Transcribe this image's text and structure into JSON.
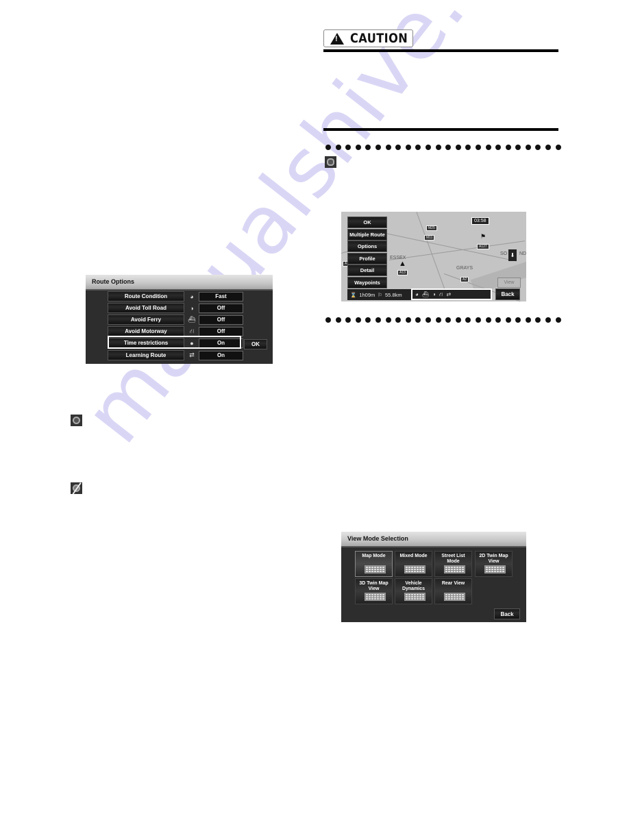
{
  "watermark": "manualshive.com",
  "caution": {
    "label": "CAUTION",
    "icon": "warning-triangle-icon"
  },
  "inline_icons": {
    "setting_icon": "route-setting-icon",
    "on_icon": "option-on-icon",
    "off_icon": "option-off-icon"
  },
  "route_options_screen": {
    "title": "Route Options",
    "rows": [
      {
        "label": "Route Condition",
        "icon": "route-condition-icon",
        "glyph": "◕",
        "value": "Fast"
      },
      {
        "label": "Avoid Toll Road",
        "icon": "toll-road-icon",
        "glyph": "◑",
        "value": "Off"
      },
      {
        "label": "Avoid Ferry",
        "icon": "ferry-icon",
        "glyph": "⛴",
        "value": "Off"
      },
      {
        "label": "Avoid Motorway",
        "icon": "motorway-icon",
        "glyph": "⛙",
        "value": "Off"
      },
      {
        "label": "Time restrictions",
        "icon": "time-restriction-icon",
        "glyph": "●",
        "value": "On"
      },
      {
        "label": "Learning Route",
        "icon": "learning-route-icon",
        "glyph": "⇄",
        "value": "On"
      }
    ],
    "selected_row": "Time restrictions",
    "ok_label": "OK"
  },
  "route_map_screen": {
    "menu": [
      "OK",
      "Multiple Route",
      "Options",
      "Profile",
      "Detail",
      "Waypoints"
    ],
    "clock": "03:58",
    "travel_time": "1h09m",
    "distance": "55.8km",
    "status_icons": [
      "route-condition-icon",
      "ferry-icon",
      "toll-road-icon",
      "motorway-icon",
      "learning-route-icon"
    ],
    "view_label": "View",
    "back_label": "Back",
    "map_labels": [
      "GRAYS",
      "ESSEX",
      "SO",
      "ND"
    ]
  },
  "view_mode_screen": {
    "title": "View Mode Selection",
    "buttons": [
      {
        "label": "Map Mode",
        "active": true
      },
      {
        "label": "Mixed Mode",
        "active": false
      },
      {
        "label": "Street List Mode",
        "active": false
      },
      {
        "label": "2D Twin Map View",
        "active": false
      },
      {
        "label": "3D Twin Map View",
        "active": false
      },
      {
        "label": "Vehicle Dynamics",
        "active": false
      },
      {
        "label": "Rear View",
        "active": false
      }
    ],
    "back_label": "Back"
  }
}
